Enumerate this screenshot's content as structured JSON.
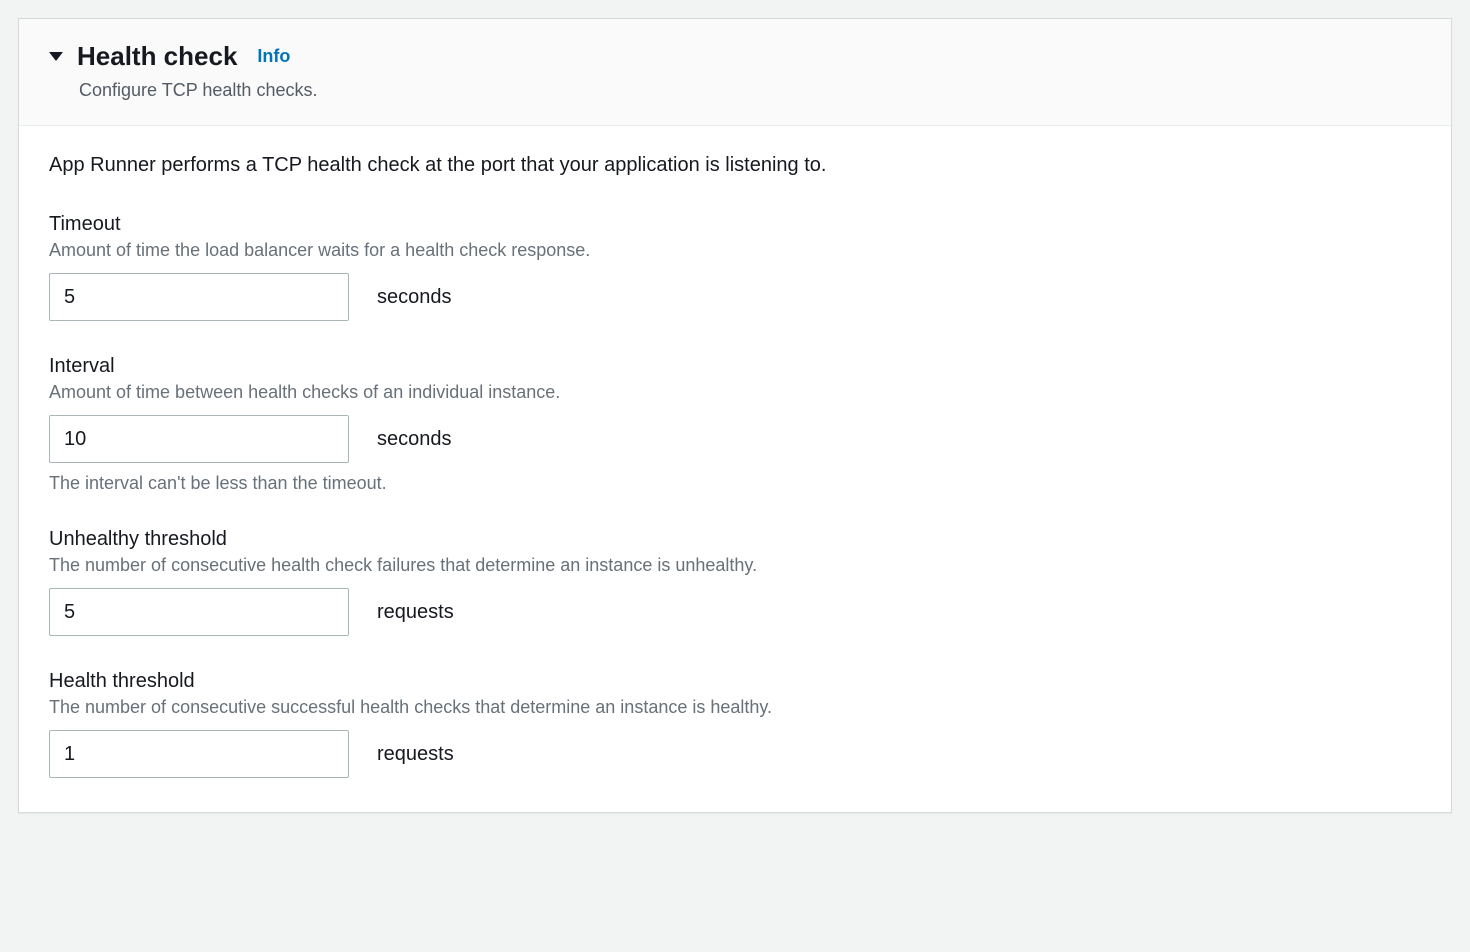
{
  "header": {
    "title": "Health check",
    "info_label": "Info",
    "subtitle": "Configure TCP health checks."
  },
  "intro": "App Runner performs a TCP health check at the port that your application is listening to.",
  "fields": {
    "timeout": {
      "label": "Timeout",
      "hint": "Amount of time the load balancer waits for a health check response.",
      "value": "5",
      "unit": "seconds"
    },
    "interval": {
      "label": "Interval",
      "hint": "Amount of time between health checks of an individual instance.",
      "value": "10",
      "unit": "seconds",
      "note": "The interval can't be less than the timeout."
    },
    "unhealthy": {
      "label": "Unhealthy threshold",
      "hint": "The number of consecutive health check failures that determine an instance is unhealthy.",
      "value": "5",
      "unit": "requests"
    },
    "healthy": {
      "label": "Health threshold",
      "hint": "The number of consecutive successful health checks that determine an instance is healthy.",
      "value": "1",
      "unit": "requests"
    }
  }
}
